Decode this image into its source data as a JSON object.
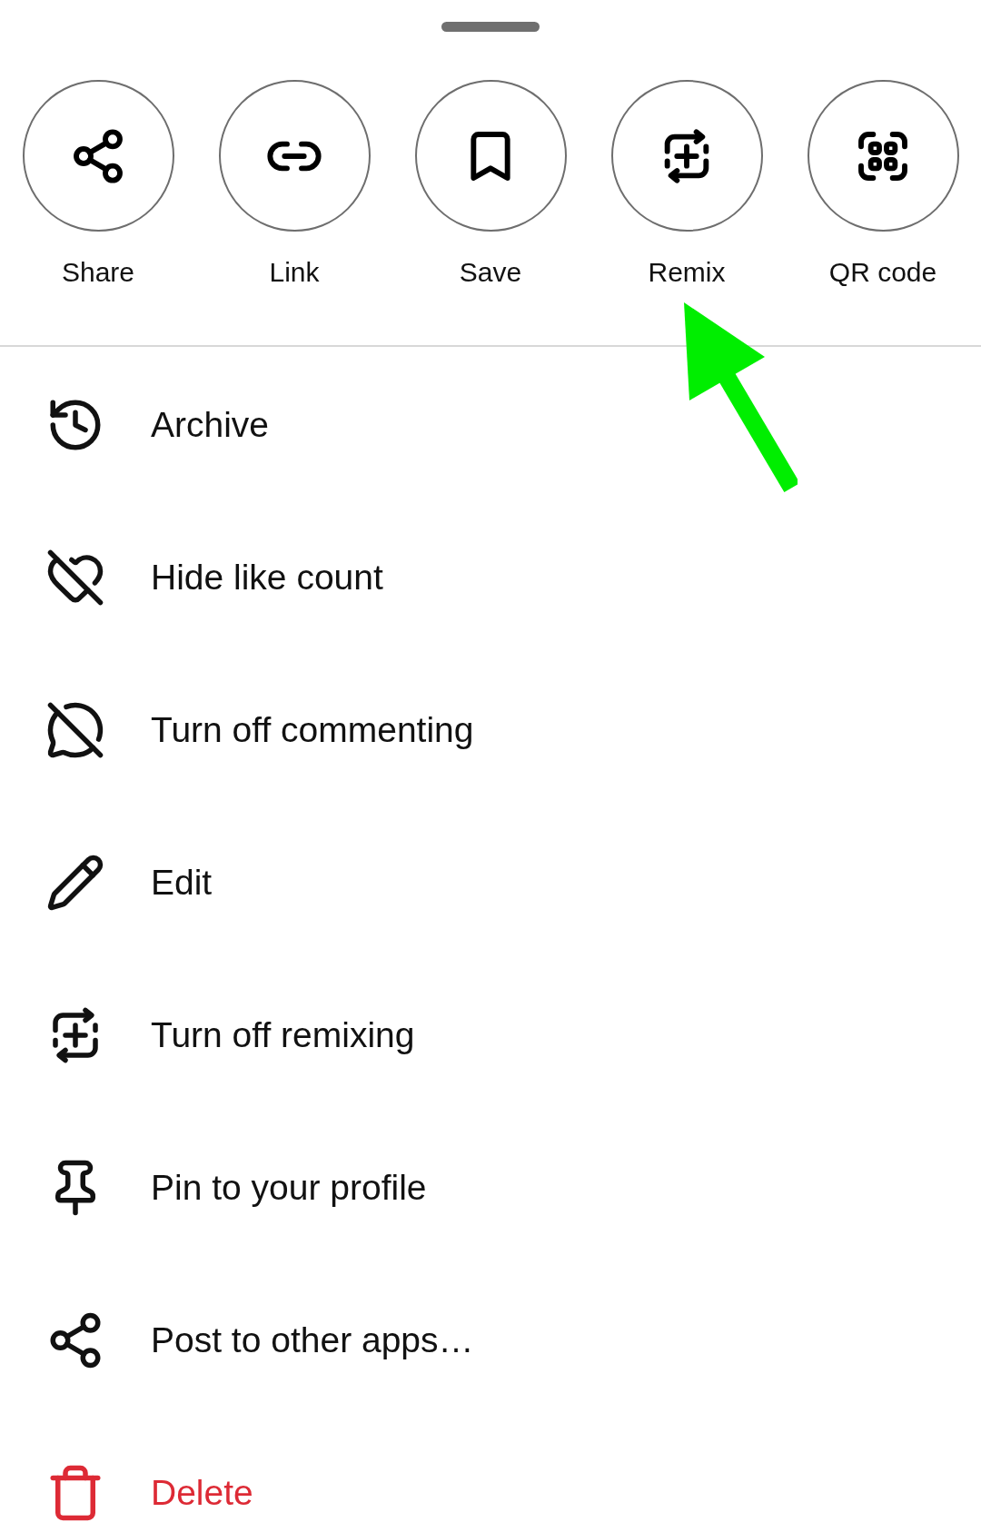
{
  "actions": [
    {
      "label": "Share"
    },
    {
      "label": "Link"
    },
    {
      "label": "Save"
    },
    {
      "label": "Remix"
    },
    {
      "label": "QR code"
    }
  ],
  "menu": [
    {
      "label": "Archive",
      "kind": "normal"
    },
    {
      "label": "Hide like count",
      "kind": "normal"
    },
    {
      "label": "Turn off commenting",
      "kind": "normal"
    },
    {
      "label": "Edit",
      "kind": "normal"
    },
    {
      "label": "Turn off remixing",
      "kind": "normal"
    },
    {
      "label": "Pin to your profile",
      "kind": "normal"
    },
    {
      "label": "Post to other apps…",
      "kind": "normal"
    },
    {
      "label": "Delete",
      "kind": "danger"
    }
  ]
}
